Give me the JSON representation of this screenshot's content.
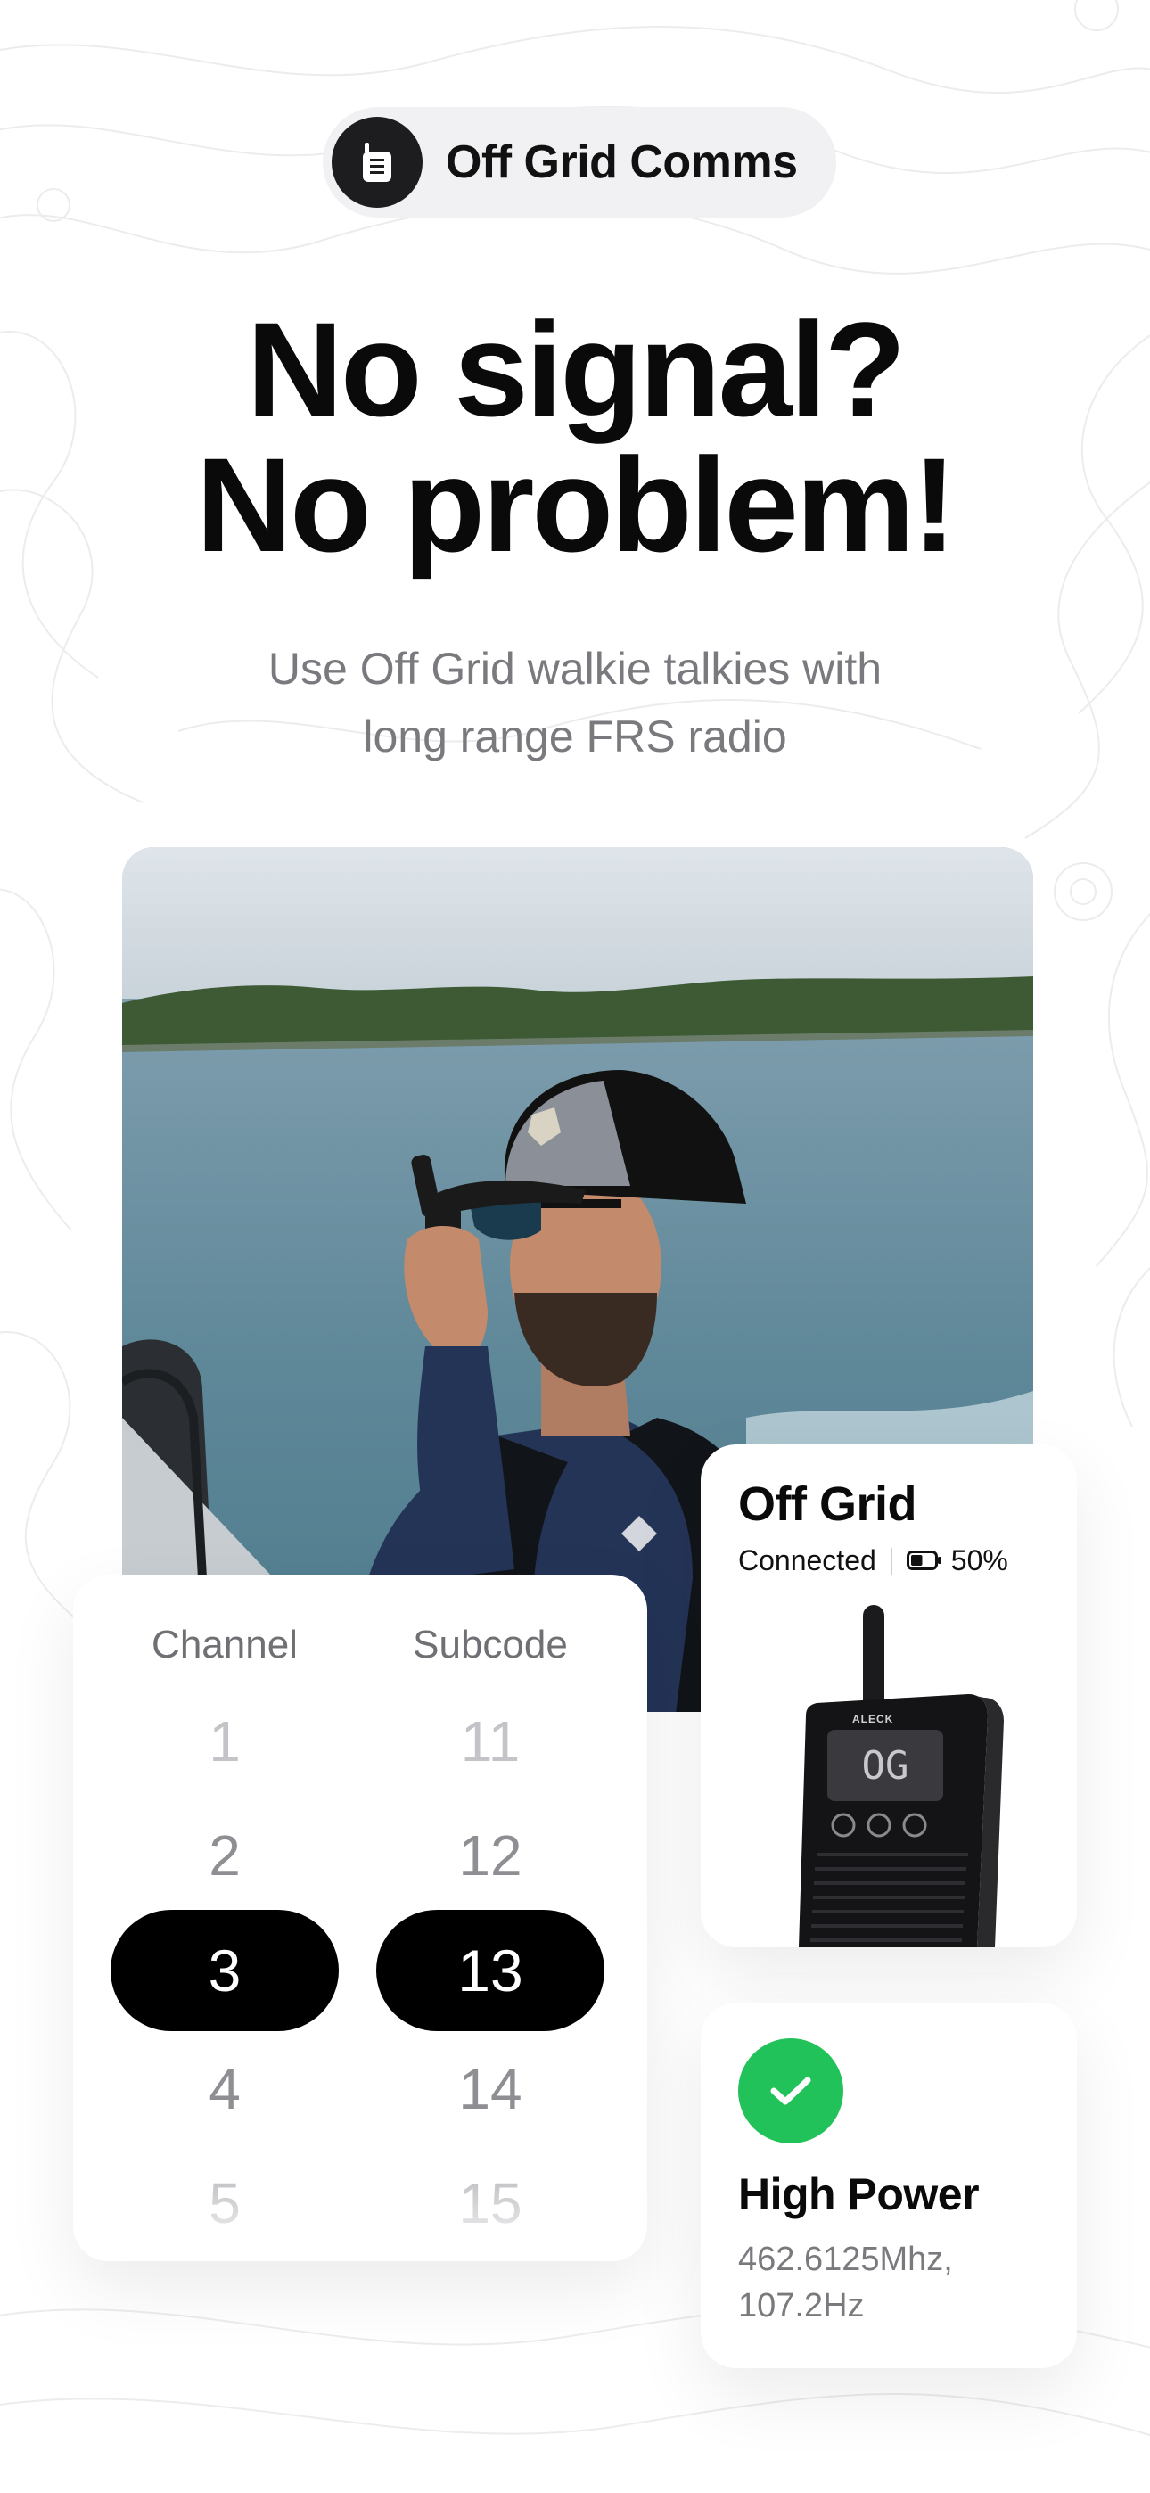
{
  "header": {
    "app_name": "Off Grid Comms",
    "icon": "walkie-talkie-icon"
  },
  "hero": {
    "headline_line1": "No signal?",
    "headline_line2": "No problem!",
    "subtitle_line1": "Use Off Grid walkie talkies with",
    "subtitle_line2": "long range FRS radio"
  },
  "picker": {
    "channel_label": "Channel",
    "subcode_label": "Subcode",
    "channels": [
      "1",
      "2",
      "3",
      "4",
      "5"
    ],
    "subcodes": [
      "11",
      "12",
      "13",
      "14",
      "15"
    ],
    "selected_channel": "3",
    "selected_subcode": "13"
  },
  "device": {
    "name": "Off Grid",
    "status": "Connected",
    "battery": "50%",
    "battery_level": 0.5,
    "screen_text": "OG",
    "brand": "ALECK"
  },
  "power": {
    "title": "High Power",
    "freq_line1": "462.6125Mhz,",
    "freq_line2": "107.2Hz",
    "status_icon": "checkmark-icon"
  },
  "colors": {
    "accent_green": "#22c25a",
    "selected_bg": "#000000",
    "pill_bg": "#f1f1f4"
  }
}
